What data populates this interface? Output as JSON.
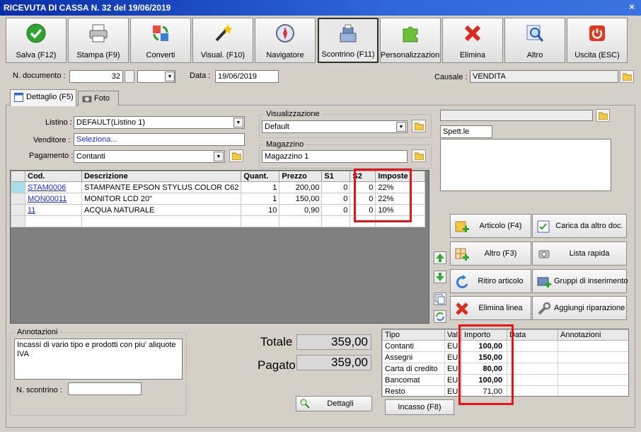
{
  "window": {
    "title": "RICEVUTA DI CASSA N. 32 del 19/06/2019",
    "close": "×"
  },
  "toolbar": [
    {
      "label": "Salva (F12)",
      "icon": "checkmark-icon"
    },
    {
      "label": "Stampa (F9)",
      "icon": "printer-icon"
    },
    {
      "label": "Converti",
      "icon": "convert-icon"
    },
    {
      "label": "Visual. (F10)",
      "icon": "magic-wand-icon"
    },
    {
      "label": "Navigatore",
      "icon": "compass-icon"
    },
    {
      "label": "Scontrino (F11)",
      "icon": "cash-register-icon"
    },
    {
      "label": "Personalizzazioni",
      "icon": "puzzle-icon"
    },
    {
      "label": "Elimina",
      "icon": "delete-icon"
    },
    {
      "label": "Altro",
      "icon": "magnifier-icon"
    },
    {
      "label": "Uscita (ESC)",
      "icon": "power-icon"
    }
  ],
  "header": {
    "doc_label": "N. documento :",
    "doc_number": "32",
    "date_label": "Data :",
    "date": "19/06/2019",
    "causale_label": "Causale :",
    "causale": "VENDITA"
  },
  "tabs": [
    {
      "label": "Dettaglio (F5)"
    },
    {
      "label": "Foto"
    }
  ],
  "form": {
    "listino_label": "Listino :",
    "listino": "DEFAULT(Listino 1)",
    "venditore_label": "Venditore :",
    "venditore": "Seleziona...",
    "pagamento_label": "Pagamento :",
    "pagamento": "Contanti",
    "visualizzazione_label": "Visualizzazione",
    "visualizzazione": "Default",
    "magazzino_label": "Magazzino",
    "magazzino": "Magazzino 1",
    "cliente_text": "Spett.le"
  },
  "grid": {
    "columns": [
      "Cod.",
      "Descrizione",
      "Quant.",
      "Prezzo",
      "S1",
      "S2",
      "Imposte"
    ],
    "rows": [
      {
        "code": "STAM0006",
        "desc": "STAMPANTE EPSON STYLUS COLOR C62",
        "qty": "1",
        "price": "200,00",
        "s1": "0",
        "s2": "0",
        "tax": "22%"
      },
      {
        "code": "MON00011",
        "desc": "MONITOR LCD 20\"",
        "qty": "1",
        "price": "150,00",
        "s1": "0",
        "s2": "0",
        "tax": "22%"
      },
      {
        "code": "11",
        "desc": "ACQUA NATURALE",
        "qty": "10",
        "price": "0,90",
        "s1": "0",
        "s2": "0",
        "tax": "10%"
      }
    ]
  },
  "actions": [
    {
      "label": "Articolo (F4)",
      "icon": "add-article-icon"
    },
    {
      "label": "Carica da altro doc.",
      "icon": "load-document-icon"
    },
    {
      "label": "Altro (F3)",
      "icon": "add-other-icon"
    },
    {
      "label": "Lista rapida",
      "icon": "quick-list-icon"
    },
    {
      "label": "Ritiro articolo",
      "icon": "return-article-icon"
    },
    {
      "label": "Gruppi di inserimento",
      "icon": "insert-groups-icon"
    },
    {
      "label": "Elimina linea",
      "icon": "delete-line-icon"
    },
    {
      "label": "Aggiungi riparazione",
      "icon": "wrench-icon"
    }
  ],
  "annotations": {
    "label": "Annotazioni",
    "text": "Incassi di vario tipo e prodotti con piu' aliquote IVA",
    "scontrino_label": "N. scontrino :",
    "scontrino": ""
  },
  "totals": {
    "totale_label": "Totale",
    "totale": "359,00",
    "pagato_label": "Pagato",
    "pagato": "359,00",
    "dettagli_label": "Dettagli"
  },
  "payments": {
    "columns": [
      "Tipo",
      "Val",
      "Importo",
      "Data",
      "Annotazioni"
    ],
    "rows": [
      {
        "tipo": "Contanti",
        "val": "EU",
        "importo": "100,00"
      },
      {
        "tipo": "Assegni",
        "val": "EU",
        "importo": "150,00"
      },
      {
        "tipo": "Carta di credito",
        "val": "EU",
        "importo": "80,00"
      },
      {
        "tipo": "Bancomat",
        "val": "EU",
        "importo": "100,00"
      },
      {
        "tipo": "Resto",
        "val": "EU",
        "importo": "71,00"
      }
    ],
    "incasso_label": "Incasso (F8)"
  },
  "colors": {
    "title_bar": "#2f66d9",
    "highlight": "#e0161b",
    "link": "#1a2fd0",
    "current_row": "#a8dde8"
  }
}
